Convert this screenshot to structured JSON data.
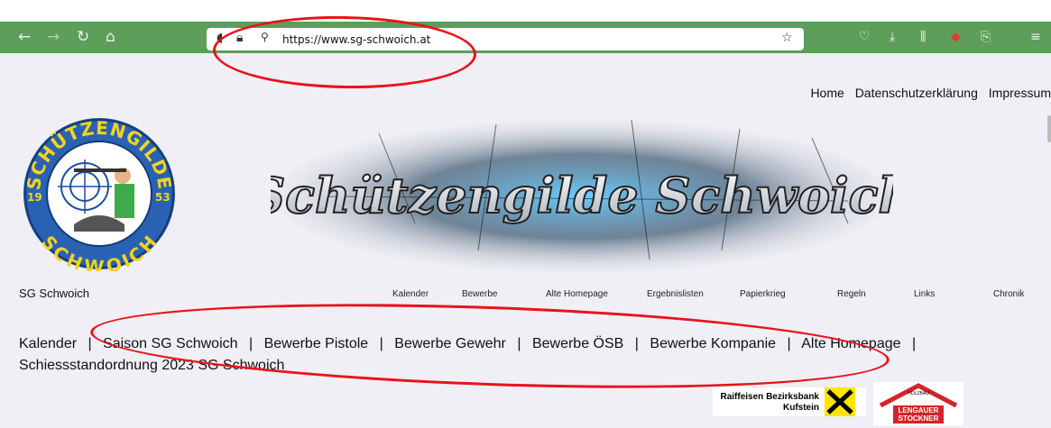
{
  "browser": {
    "url": "https://www.sg-schwoich.at",
    "icons": [
      "back-icon",
      "forward-icon",
      "reload-icon",
      "home-icon",
      "shield-icon",
      "lock-icon",
      "permissions-icon",
      "bookmark-star-icon",
      "pocket-icon",
      "download-icon",
      "library-icon",
      "extension-icon",
      "share-icon",
      "menu-icon"
    ]
  },
  "header": {
    "links": [
      "Home",
      "Datenschutzerklärung",
      "Impressum"
    ]
  },
  "logo": {
    "text_top": "SCHÜTZENGILDE",
    "text_bottom": "SCHWOICH",
    "year_left": "19",
    "year_right": "53"
  },
  "banner": {
    "title": "Schützengilde Schwoich"
  },
  "site_name": "SG Schwoich",
  "menu": [
    "Kalender",
    "Bewerbe",
    "Alte Homepage",
    "Ergebnislisten",
    "Papierkrieg",
    "Regeln",
    "Links",
    "Chronik"
  ],
  "breadcrumb": {
    "items": [
      "Kalender",
      "Saison SG Schwoich",
      "Bewerbe Pistole",
      "Bewerbe Gewehr",
      "Bewerbe ÖSB",
      "Bewerbe Kompanie",
      "Alte Homepage",
      "Schiessstandordnung 2023 SG Schwoich"
    ],
    "separator": "|"
  },
  "sponsors": {
    "bank_line1": "Raiffeisen Bezirksbank",
    "bank_line2": "Kufstein",
    "holzbau_small": "HOLZBAU",
    "holzbau_line1": "LENGAUER",
    "holzbau_line2": "STOCKNER"
  },
  "colors": {
    "toolbar": "#5c9e5a",
    "annotation": "#e8131a"
  }
}
